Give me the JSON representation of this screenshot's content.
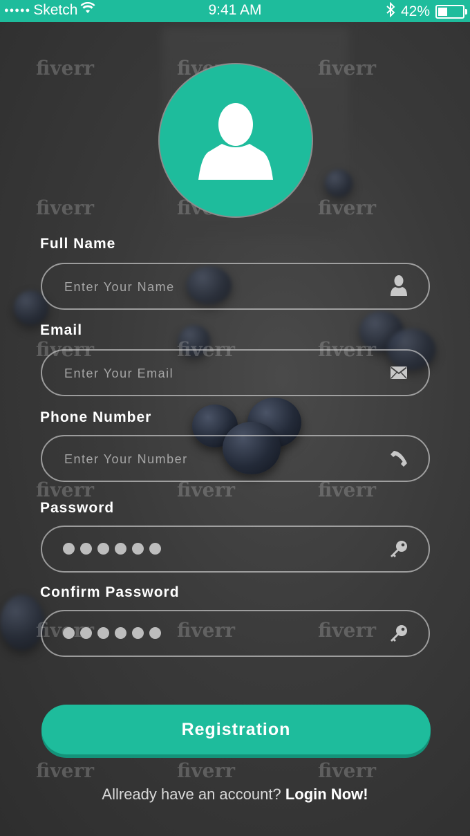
{
  "status_bar": {
    "signal_dots": "●●●●●",
    "carrier": "Sketch",
    "time": "9:41 AM",
    "battery_percent": "42%",
    "battery_level": 0.42,
    "icons": [
      "wifi-icon",
      "bluetooth-icon",
      "battery-icon"
    ]
  },
  "avatar": {
    "icon": "user-icon"
  },
  "form": {
    "full_name": {
      "label": "Full Name",
      "placeholder": "Enter Your Name",
      "icon": "user-icon"
    },
    "email": {
      "label": "Email",
      "placeholder": "Enter Your Email",
      "icon": "envelope-icon"
    },
    "phone": {
      "label": "Phone Number",
      "placeholder": "Enter Your Number",
      "icon": "phone-icon"
    },
    "password": {
      "label": "Password",
      "masked_value": "●●●●●●",
      "icon": "key-icon"
    },
    "confirm_password": {
      "label": "Confirm Password",
      "masked_value": "●●●●●●",
      "icon": "key-icon"
    }
  },
  "register_button": {
    "label": "Registration"
  },
  "login_prompt": {
    "text": "Allready have an account?",
    "link": "Login Now!"
  },
  "watermark": "fiverr",
  "colors": {
    "accent": "#1ebc9c",
    "background": "#3a3a3a",
    "text": "#ffffff"
  }
}
